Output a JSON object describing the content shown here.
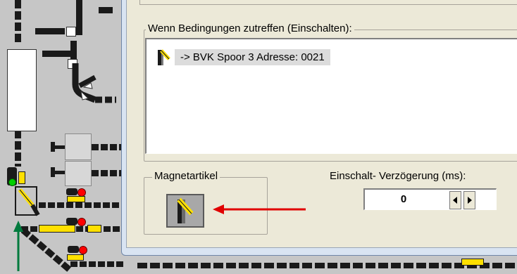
{
  "condition_group": {
    "legend": "Wenn Bedingungen zutreffen (Einschalten):"
  },
  "condition_list": {
    "items": [
      {
        "icon": "turnout-icon",
        "text": "-> BVK Spoor 3 Adresse: 0021"
      }
    ]
  },
  "magnet_group": {
    "legend": "Magnetartikel",
    "icon": "turnout-switch-icon"
  },
  "delay": {
    "label": "Einschalt- Verzögerung (ms):",
    "value": "0"
  },
  "annotations": {
    "red_arrow_color": "#e00000",
    "green_arrow_color": "#007a3d"
  },
  "colors": {
    "track_background": "#c6c6c6",
    "dialog_frame": "#d9e4f2",
    "dialog_face": "#ece9d8",
    "signal_yellow": "#ffe000",
    "signal_red": "#ff0000",
    "signal_green": "#00d000"
  }
}
